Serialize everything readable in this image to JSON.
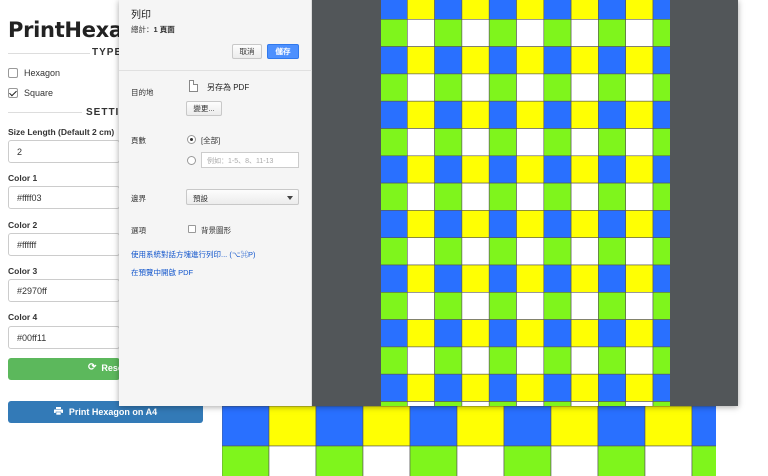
{
  "app": {
    "title": "PrintHexagon",
    "type_heading": "TYPE",
    "settings_heading": "SETTING",
    "shape_options": [
      {
        "label": "Hexagon",
        "checked": false
      },
      {
        "label": "Square",
        "checked": true
      }
    ],
    "size_label": "Size Length (Default 2 cm)",
    "size_value": "2",
    "colors": [
      {
        "label": "Color 1",
        "value": "#ffff03"
      },
      {
        "label": "Color 2",
        "value": "#ffffff"
      },
      {
        "label": "Color 3",
        "value": "#2970ff"
      },
      {
        "label": "Color 4",
        "value": "#00ff11"
      }
    ],
    "reset_label": "Rese",
    "print_label": "Print Hexagon on A4"
  },
  "dialog": {
    "title": "列印",
    "total_label": "總計：",
    "total_value": "1 頁面",
    "cancel_label": "取消",
    "save_label": "儲存",
    "destination_label": "目的地",
    "destination_value": "另存為 PDF",
    "change_label": "變更...",
    "pages_label": "頁數",
    "pages_all": "[全部]",
    "pages_placeholder": "例如：1-5、8、11-13",
    "margins_label": "邊界",
    "margins_value": "預設",
    "options_label": "選項",
    "background_graphics_label": "背景圖形",
    "system_dialog_link": "使用系統對話方塊進行列印... (⌥⌘P)",
    "open_preview_link": "在預覽中開啟 PDF"
  },
  "palette": {
    "yellow": "#ffff03",
    "white": "#ffffff",
    "blue": "#2970ff",
    "green": "#7ff51c",
    "grid_line": "#555555",
    "preview_bg": "#525659",
    "save_button": "#4d90fe",
    "reset_button": "#5cb85c",
    "print_button": "#337ab7"
  },
  "icons": {
    "refresh": "refresh-icon",
    "printer": "printer-icon",
    "pdf": "pdf-file-icon"
  }
}
